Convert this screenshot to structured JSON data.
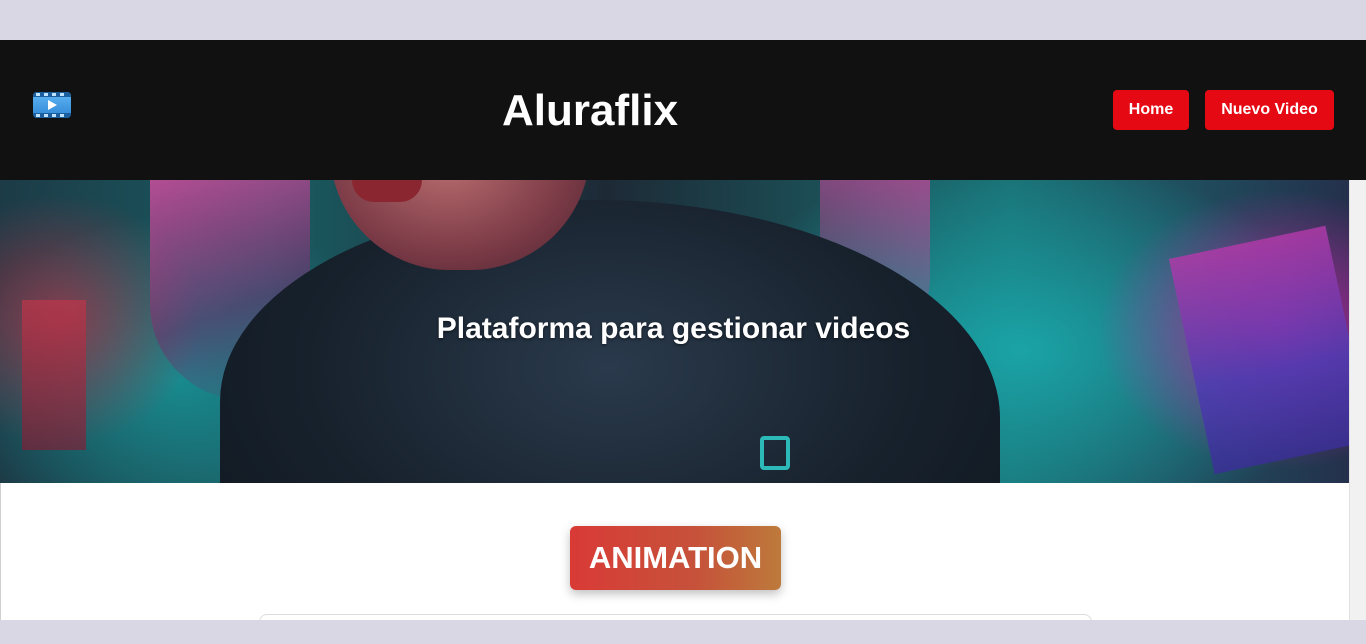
{
  "header": {
    "logo_icon": "film-play-icon",
    "title": "Aluraflix",
    "nav": {
      "home_label": "Home",
      "new_video_label": "Nuevo Video"
    },
    "accent_color": "#e50914"
  },
  "hero": {
    "tagline": "Plataforma para gestionar videos"
  },
  "categories": [
    {
      "label": "ANIMATION"
    }
  ]
}
